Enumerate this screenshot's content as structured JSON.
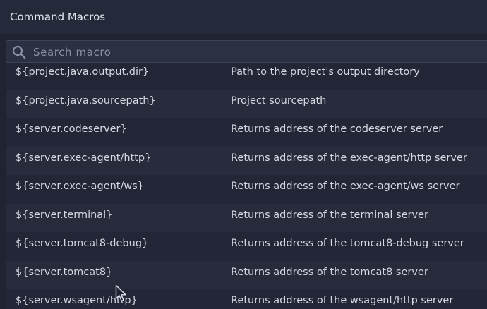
{
  "window": {
    "title": "Command Macros"
  },
  "search": {
    "placeholder": "Search macro",
    "value": ""
  },
  "macros": [
    {
      "name": "${project.java.output.dir}",
      "description": "Path to the project's output directory"
    },
    {
      "name": "${project.java.sourcepath}",
      "description": "Project sourcepath"
    },
    {
      "name": "${server.codeserver}",
      "description": "Returns address of the codeserver server"
    },
    {
      "name": "${server.exec-agent/http}",
      "description": "Returns address of the exec-agent/http server"
    },
    {
      "name": "${server.exec-agent/ws}",
      "description": "Returns address of the exec-agent/ws server"
    },
    {
      "name": "${server.terminal}",
      "description": "Returns address of the terminal server"
    },
    {
      "name": "${server.tomcat8-debug}",
      "description": "Returns address of the tomcat8-debug server"
    },
    {
      "name": "${server.tomcat8}",
      "description": "Returns address of the tomcat8 server"
    },
    {
      "name": "${server.wsagent/http}",
      "description": "Returns address of the wsagent/http server"
    }
  ],
  "icons": {
    "search": "search-icon",
    "cursor": "mouse-pointer-icon"
  },
  "colors": {
    "background": "#1f2332",
    "titlebar": "#252a3a",
    "text": "#d6d8e1"
  }
}
